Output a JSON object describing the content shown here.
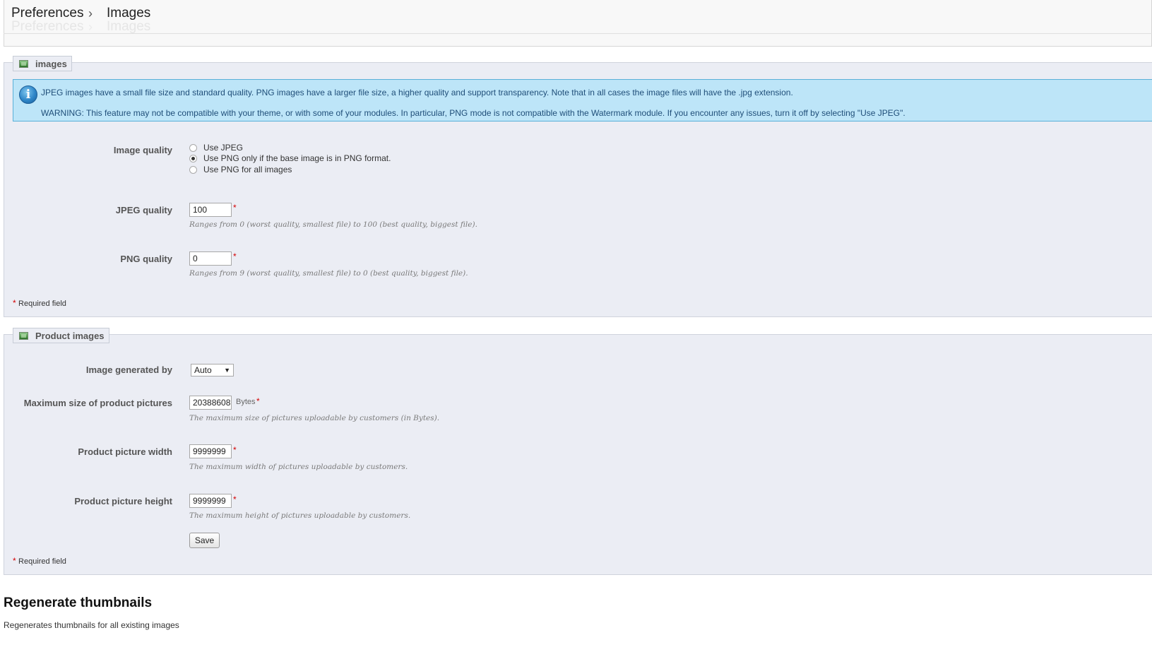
{
  "breadcrumb": {
    "items": [
      "Preferences",
      "Images"
    ]
  },
  "images_section": {
    "legend": "images",
    "info": {
      "line1": "JPEG images have a small file size and standard quality. PNG images have a larger file size, a higher quality and support transparency. Note that in all cases the image files will have the .jpg extension.",
      "line2": "WARNING: This feature may not be compatible with your theme, or with some of your modules. In particular, PNG mode is not compatible with the Watermark module. If you encounter any issues, turn it off by selecting \"Use JPEG\"."
    },
    "image_quality": {
      "label": "Image quality",
      "options": [
        "Use JPEG",
        "Use PNG only if the base image is in PNG format.",
        "Use PNG for all images"
      ],
      "selected": 1
    },
    "jpeg_quality": {
      "label": "JPEG quality",
      "value": "100",
      "hint": "Ranges from 0 (worst quality, smallest file) to 100 (best quality, biggest file)."
    },
    "png_quality": {
      "label": "PNG quality",
      "value": "0",
      "hint": "Ranges from 9 (worst quality, smallest file) to 0 (best quality, biggest file)."
    },
    "required_note": "Required field"
  },
  "product_section": {
    "legend": "Product images",
    "generated_by": {
      "label": "Image generated by",
      "value": "Auto"
    },
    "max_size": {
      "label": "Maximum size of product pictures",
      "value": "20388608",
      "unit": "Bytes",
      "hint": "The maximum size of pictures uploadable by customers (in Bytes)."
    },
    "width": {
      "label": "Product picture width",
      "value": "9999999",
      "hint": "The maximum width of pictures uploadable by customers."
    },
    "height": {
      "label": "Product picture height",
      "value": "9999999",
      "hint": "The maximum height of pictures uploadable by customers."
    },
    "save_label": "Save",
    "required_note": "Required field"
  },
  "regenerate": {
    "title": "Regenerate thumbnails",
    "description": "Regenerates thumbnails for all existing images"
  },
  "colors": {
    "fieldset_bg": "#ebedf4",
    "info_bg": "#bde5f8",
    "required": "#d40000"
  },
  "icons": {
    "legend": "image-icon",
    "info": "info-icon",
    "separator": "chevron-right-icon"
  }
}
